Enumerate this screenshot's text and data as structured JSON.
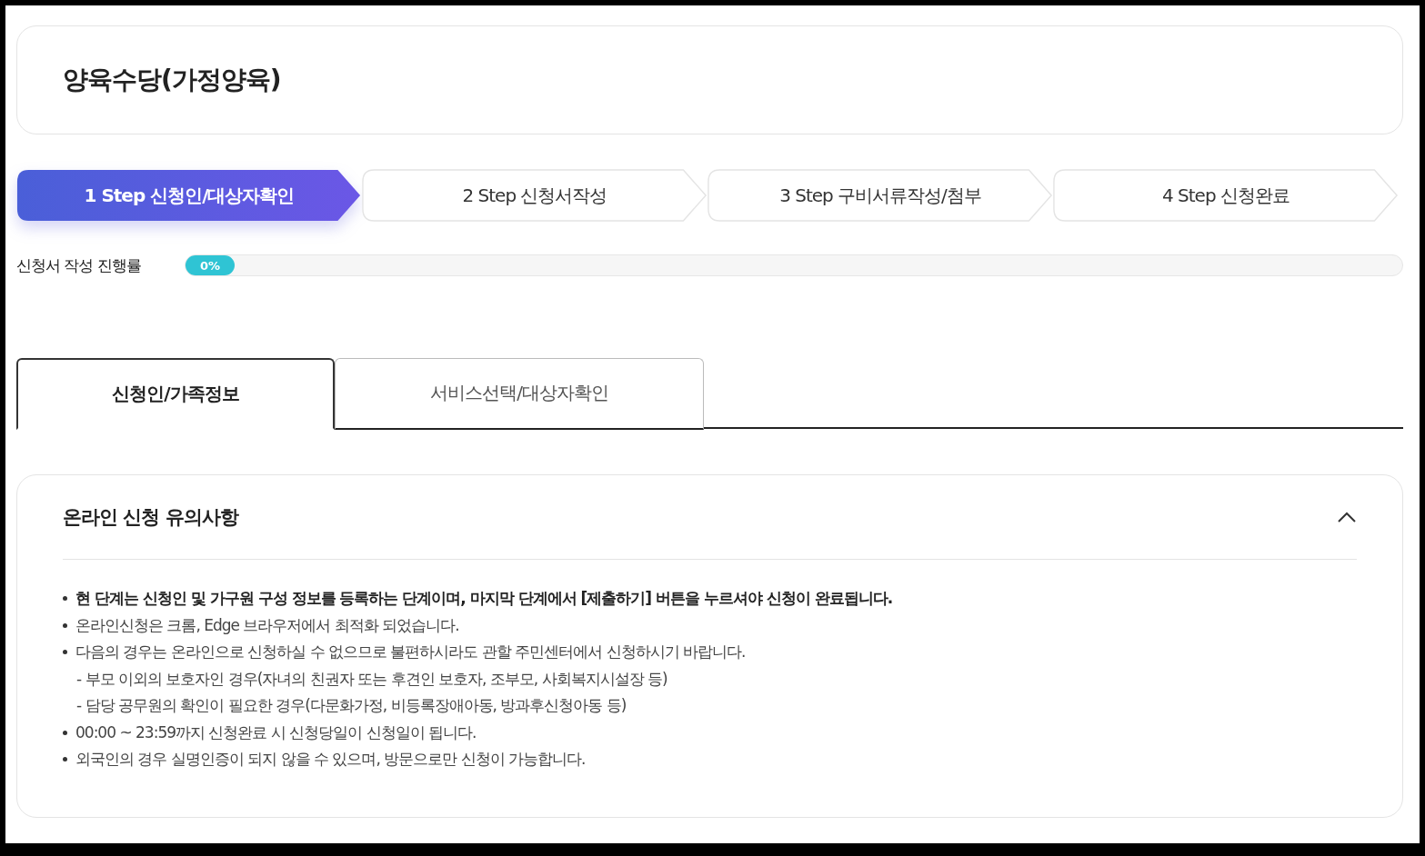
{
  "page_title": "양육수당(가정양육)",
  "steps": [
    {
      "label": "1 Step 신청인/대상자확인",
      "selected": true
    },
    {
      "label": "2 Step 신청서작성",
      "selected": false
    },
    {
      "label": "3 Step 구비서류작성/첨부",
      "selected": false
    },
    {
      "label": "4 Step 신청완료",
      "selected": false
    }
  ],
  "progress": {
    "label": "신청서 작성 진행률",
    "level": 0,
    "reading": "0%"
  },
  "tabs": [
    {
      "label": "신청인/가족정보",
      "selected": true
    },
    {
      "label": "서비스선택/대상자확인",
      "selected": false
    }
  ],
  "notice": {
    "title": "온라인 신청 유의사항",
    "expanded": true,
    "items": [
      {
        "kind": "bullet",
        "bold": true,
        "text": "현 단계는 신청인 및 가구원 구성 정보를 등록하는 단계이며, 마지막 단계에서 [제출하기] 버튼을 누르셔야 신청이 완료됩니다."
      },
      {
        "kind": "bullet",
        "bold": false,
        "text": "온라인신청은 크롬, Edge 브라우저에서 최적화 되었습니다."
      },
      {
        "kind": "bullet",
        "bold": false,
        "text": "다음의 경우는 온라인으로 신청하실 수 없으므로 불편하시라도 관할 주민센터에서 신청하시기 바랍니다."
      },
      {
        "kind": "sub",
        "bold": false,
        "text": "- 부모 이외의 보호자인 경우(자녀의 친권자 또는 후견인 보호자, 조부모, 사회복지시설장 등)"
      },
      {
        "kind": "sub",
        "bold": false,
        "text": "- 담당 공무원의 확인이 필요한 경우(다문화가정, 비등록장애아동, 방과후신청아동 등)"
      },
      {
        "kind": "bullet",
        "bold": false,
        "text": "00:00 ~ 23:59까지 신청완료 시 신청당일이 신청일이 됩니다."
      },
      {
        "kind": "bullet",
        "bold": false,
        "text": "외국인의 경우 실명인증이 되지 않을 수 있으며, 방문으로만 신청이 가능합니다."
      }
    ]
  }
}
